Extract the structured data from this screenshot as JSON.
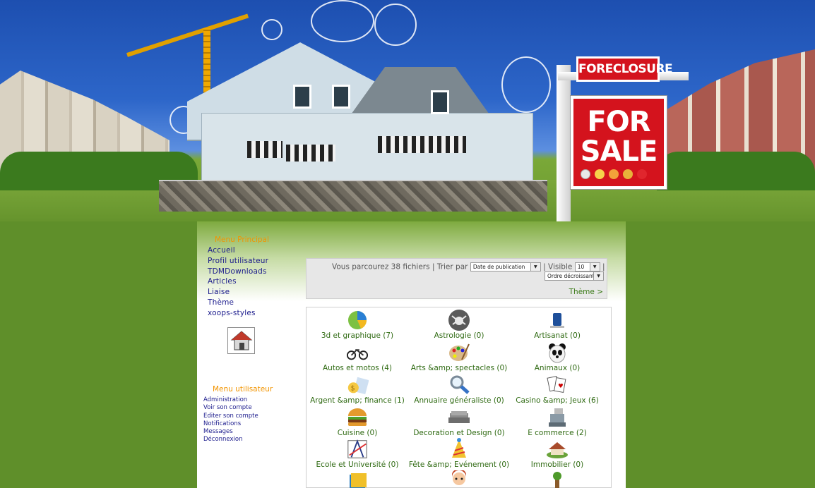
{
  "banner": {
    "sign_top": "FORECLOSURE",
    "sign_line1": "FOR",
    "sign_line2": "SALE"
  },
  "main_menu": {
    "title": "Menu Principal",
    "items": [
      {
        "label": "Accueil"
      },
      {
        "label": "Profil utilisateur"
      },
      {
        "label": "TDMDownloads"
      },
      {
        "label": "Articles"
      },
      {
        "label": "Liaise"
      },
      {
        "label": "Thème"
      },
      {
        "label": "xoops-styles"
      }
    ]
  },
  "user_menu": {
    "title": "Menu utilisateur",
    "items": [
      {
        "label": "Administration"
      },
      {
        "label": "Voir son compte"
      },
      {
        "label": "Editer son compte"
      },
      {
        "label": "Notifications"
      },
      {
        "label": "Messages"
      },
      {
        "label": "Déconnexion"
      }
    ]
  },
  "toolbar": {
    "browsing_text": "Vous parcourez 38 fichiers",
    "sep1": "|",
    "sort_label": "Trier par",
    "sort_value": "Date de publication",
    "sep2": "|",
    "visible_label": "Visible",
    "visible_value": "10",
    "sep3": "|",
    "order_value": "Ordre décroissant",
    "theme_link": "Thème >"
  },
  "categories": [
    {
      "label": "3d et graphique (7)",
      "icon": "pie-chart-icon"
    },
    {
      "label": "Astrologie (0)",
      "icon": "crab-icon"
    },
    {
      "label": "Artisanat (0)",
      "icon": "phone-icon"
    },
    {
      "label": "Autos et motos (4)",
      "icon": "motorbike-icon"
    },
    {
      "label": "Arts &amp; spectacles (0)",
      "icon": "palette-icon"
    },
    {
      "label": "Animaux (0)",
      "icon": "panda-icon"
    },
    {
      "label": "Argent &amp; finance (1)",
      "icon": "money-icon"
    },
    {
      "label": "Annuaire généraliste (0)",
      "icon": "magnifier-icon"
    },
    {
      "label": "Casino &amp; Jeux (6)",
      "icon": "cards-icon"
    },
    {
      "label": "Cuisine (0)",
      "icon": "burger-icon"
    },
    {
      "label": "Decoration et Design (0)",
      "icon": "sofa-icon"
    },
    {
      "label": "E commerce (2)",
      "icon": "cash-register-icon"
    },
    {
      "label": "Ecole et Université (0)",
      "icon": "compass-icon"
    },
    {
      "label": "Fête &amp; Evénement (0)",
      "icon": "party-icon"
    },
    {
      "label": "Immobilier (0)",
      "icon": "house-icon"
    },
    {
      "label": "",
      "icon": "book-icon"
    },
    {
      "label": "",
      "icon": "child-icon"
    },
    {
      "label": "",
      "icon": "tree-icon"
    }
  ]
}
